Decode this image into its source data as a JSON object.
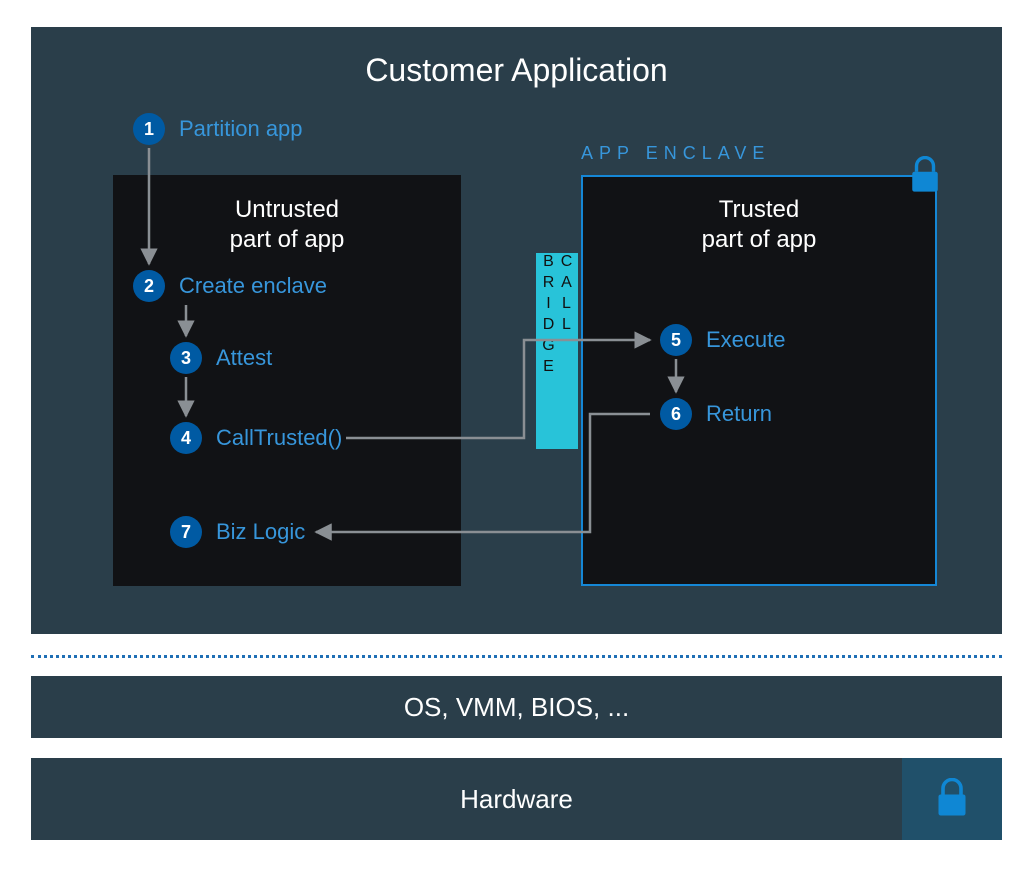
{
  "title": "Customer Application",
  "enclave_label": "APP ENCLAVE",
  "left_panel_title_line1": "Untrusted",
  "left_panel_title_line2": "part of app",
  "right_panel_title_line1": "Trusted",
  "right_panel_title_line2": "part of app",
  "bridge_label": "CALL BRIDGE",
  "steps": {
    "s1": {
      "n": "1",
      "label": "Partition app"
    },
    "s2": {
      "n": "2",
      "label": "Create enclave"
    },
    "s3": {
      "n": "3",
      "label": "Attest"
    },
    "s4": {
      "n": "4",
      "label": "CallTrusted()"
    },
    "s5": {
      "n": "5",
      "label": "Execute"
    },
    "s6": {
      "n": "6",
      "label": "Return"
    },
    "s7": {
      "n": "7",
      "label": "Biz Logic"
    }
  },
  "os_bar": "OS, VMM, BIOS, ...",
  "hw_bar": "Hardware"
}
